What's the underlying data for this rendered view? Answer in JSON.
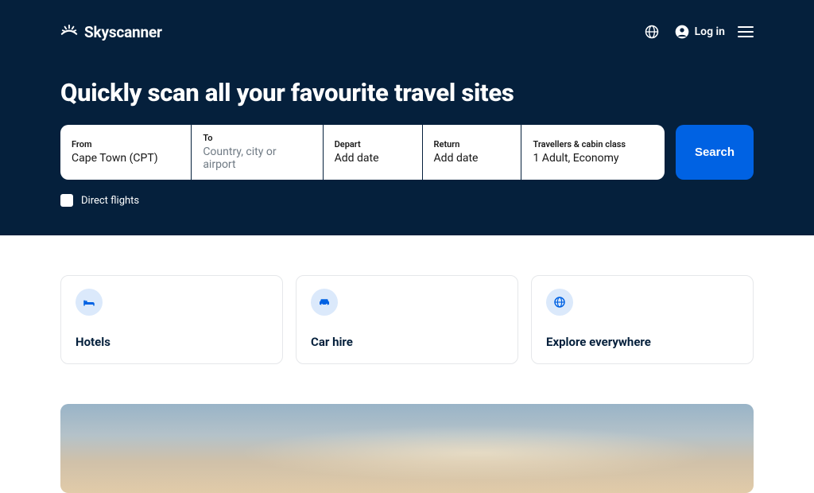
{
  "header": {
    "brand": "Skyscanner",
    "login": "Log in"
  },
  "headline": "Quickly scan all your favourite travel sites",
  "search": {
    "from_label": "From",
    "from_value": "Cape Town (CPT)",
    "to_label": "To",
    "to_placeholder": "Country, city or airport",
    "depart_label": "Depart",
    "depart_value": "Add date",
    "return_label": "Return",
    "return_value": "Add date",
    "trav_label": "Travellers & cabin class",
    "trav_value": "1 Adult, Economy",
    "button": "Search"
  },
  "options": {
    "direct_flights": "Direct flights"
  },
  "cards": [
    {
      "label": "Hotels"
    },
    {
      "label": "Car hire"
    },
    {
      "label": "Explore everywhere"
    }
  ]
}
